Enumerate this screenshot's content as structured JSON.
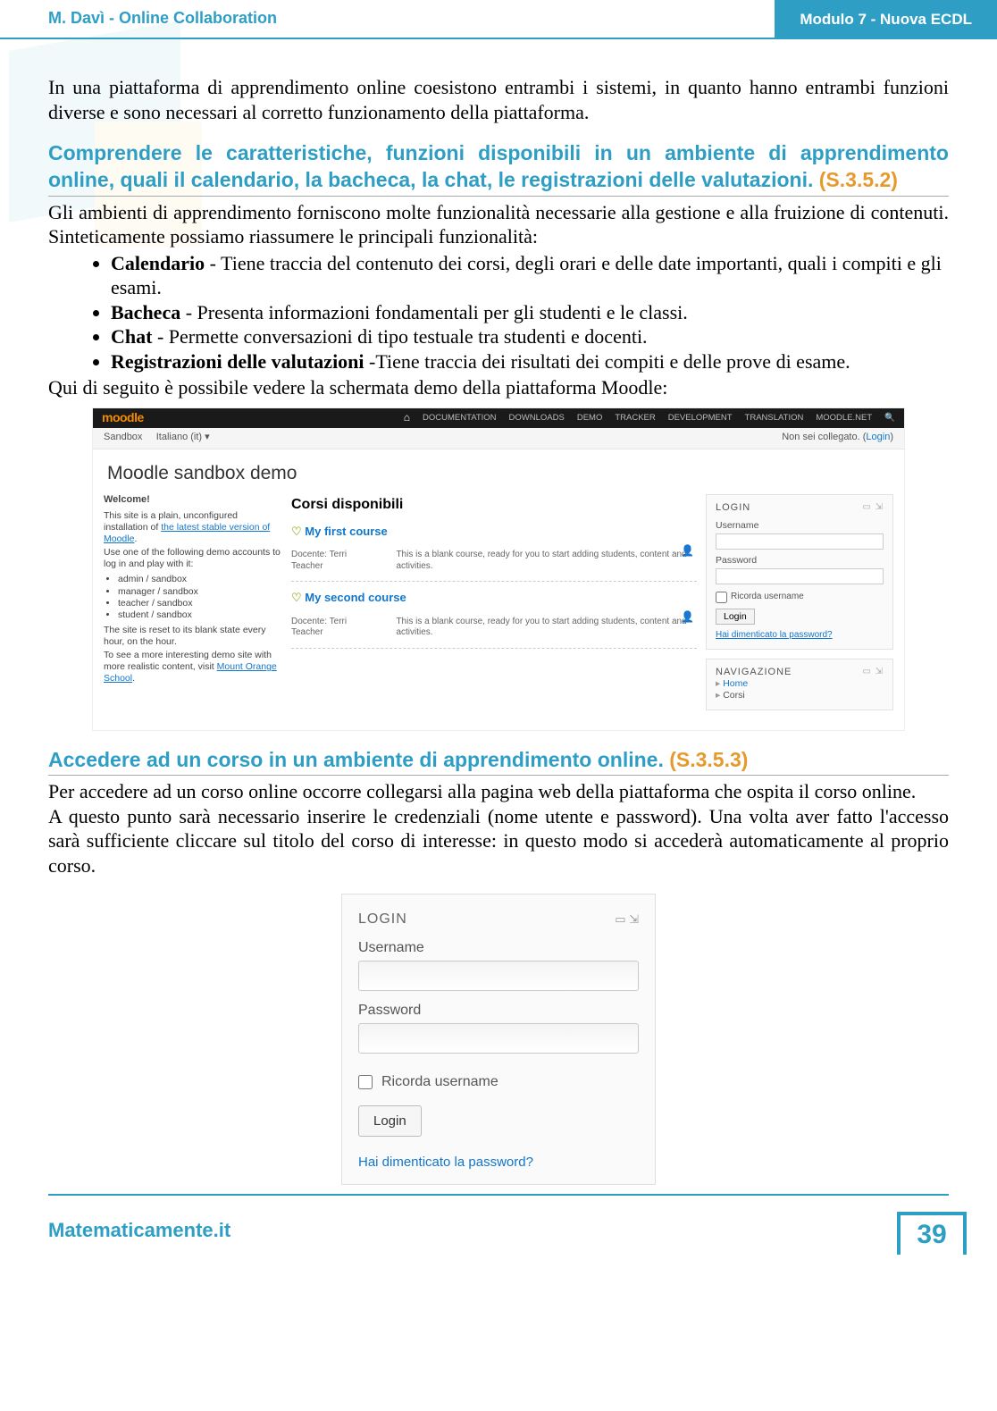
{
  "header": {
    "left": "M. Davì - Online Collaboration",
    "right": "Modulo 7 - Nuova ECDL"
  },
  "intro": "In una piattaforma di apprendimento online coesistono entrambi i sistemi, in quanto hanno entrambi funzioni diverse e sono necessari al corretto funzionamento della piattaforma.",
  "sec1": {
    "title": "Comprendere le caratteristiche, funzioni disponibili in un ambiente di apprendimento online, quali il calendario, la bacheca, la chat, le registrazioni delle valutazioni.",
    "code": "(S.3.5.2)",
    "lead": "Gli ambienti di apprendimento forniscono molte funzionalità necessarie alla gestione e alla fruizione di contenuti. Sinteticamente possiamo riassumere le principali funzionalità:",
    "items": [
      {
        "b": "Calendario",
        "t": " - Tiene traccia del contenuto dei corsi, degli orari e delle date importanti, quali i compiti e gli esami."
      },
      {
        "b": "Bacheca",
        "t": " - Presenta informazioni fondamentali per gli studenti e le classi."
      },
      {
        "b": "Chat",
        "t": " - Permette conversazioni di tipo testuale tra studenti e docenti."
      },
      {
        "b": "Registrazioni delle valutazioni",
        "t": " -Tiene traccia dei risultati dei compiti e delle prove di esame."
      }
    ],
    "closing": "Qui di seguito è possibile vedere la schermata demo della piattaforma Moodle:"
  },
  "moodle": {
    "logo": "moodle",
    "topnav": [
      "DOCUMENTATION",
      "DOWNLOADS",
      "DEMO",
      "TRACKER",
      "DEVELOPMENT",
      "TRANSLATION",
      "MOODLE.NET"
    ],
    "search_icon": "🔍",
    "sandbox": "Sandbox",
    "lang": "Italiano (it) ▾",
    "not_logged": "Non sei collegato.",
    "login_link": "Login",
    "title": "Moodle sandbox demo",
    "left": {
      "welcome": "Welcome!",
      "p1a": "This site is a plain, unconfigured installation of ",
      "p1b": "the latest stable version of Moodle",
      "p1c": ".",
      "p2": "Use one of the following demo accounts to log in and play with it:",
      "accounts": [
        "admin / sandbox",
        "manager / sandbox",
        "teacher / sandbox",
        "student / sandbox"
      ],
      "p3": "The site is reset to its blank state every hour, on the hour.",
      "p4a": "To see a more interesting demo site with more realistic content, visit ",
      "p4b": "Mount Orange School",
      "p4c": "."
    },
    "mid": {
      "heading": "Corsi disponibili",
      "courses": [
        {
          "title": "My first course",
          "teacher_lbl": "Docente:",
          "teacher": "Terri Teacher",
          "desc": "This is a blank course, ready for you to start adding students, content and activities."
        },
        {
          "title": "My second course",
          "teacher_lbl": "Docente:",
          "teacher": "Terri Teacher",
          "desc": "This is a blank course, ready for you to start adding students, content and activities."
        }
      ]
    },
    "right": {
      "login_title": "LOGIN",
      "user_lbl": "Username",
      "pass_lbl": "Password",
      "remember": "Ricorda username",
      "btn": "Login",
      "forgot": "Hai dimenticato la password?",
      "nav_title": "NAVIGAZIONE",
      "nav_home": "Home",
      "nav_corsi": "Corsi"
    }
  },
  "sec2": {
    "title": "Accedere ad un corso in un ambiente di apprendimento online.",
    "code": "(S.3.5.3)",
    "p1": "Per accedere ad un corso online occorre collegarsi alla pagina web della piattaforma che ospita il corso online.",
    "p2": "A questo punto sarà necessario inserire le credenziali (nome utente e password). Una volta aver fatto l'accesso sarà sufficiente cliccare sul titolo del corso di interesse: in questo modo si accederà automaticamente al proprio corso."
  },
  "loginbox": {
    "title": "LOGIN",
    "user": "Username",
    "pass": "Password",
    "remember": "Ricorda username",
    "btn": "Login",
    "forgot": "Hai dimenticato la password?"
  },
  "footer": {
    "site": "Matematicamente.it",
    "page": "39"
  }
}
